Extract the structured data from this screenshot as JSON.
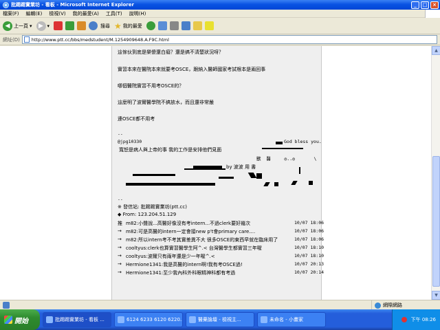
{
  "window": {
    "title": "批踢踢實業坊 - 看板 - Microsoft Internet Explorer",
    "min": "_",
    "max": "□",
    "close": "×"
  },
  "menu": [
    "檔案(F)",
    "編輯(E)",
    "檢視(V)",
    "我的最愛(A)",
    "工具(T)",
    "說明(H)"
  ],
  "toolbar": {
    "back_label": "上一頁",
    "search_label": "搜尋",
    "favorites_label": "我的最愛"
  },
  "address": {
    "label": "網址(D)",
    "url": "http://www.ptt.cc/bbs/medstudent/M.1254909648.A.F9C.html"
  },
  "post": {
    "lines": [
      "這傢伙到底是樂傻還白癡？還是搞不清楚狀況呀？",
      "實習本來在醫院本來就要考OSCE，跟納入醫師國家考試根本是兩回事",
      "哪個醫院實習不用考OSCE的？",
      "這麼明了波爾醫學院不搞放水，而且還非常嚴",
      "連OSCE都不用考"
    ],
    "sig_sep": "--",
    "sig_id": "@jpg10330",
    "sig_bless": "God bless you.",
    "sig_line1": "寬恕是病人與上帝的事 我的工作是安排他們見面",
    "sig_art1": "獸  醫     ◎..◎       \\",
    "sig_by": "by 波波 用 書",
    "footer_sep": "--",
    "footer_site": "※ 發信站: 批踢踢實業坊(ptt.cc)",
    "footer_from": "◆ From: 123.204.51.129",
    "pushes": [
      {
        "tag": "推",
        "text": "m82:小聲說...高醫好像沒有考intern...不過clerk要好幾次",
        "time": "10/07 18:06"
      },
      {
        "tag": "→",
        "text": "m82:可是高醫的intern一定會接new p't會primary care....",
        "time": "10/07 18:06"
      },
      {
        "tag": "→",
        "text": "m82:所以intern考不考其實差異不大 很多OSCE的東西早就在臨床用了",
        "time": "10/07 18:06"
      },
      {
        "tag": "→",
        "text": "cooltyus:clerk也算實習醫學生阿^.< 台灣醫學生都實習三年喔",
        "time": "10/07 18:10"
      },
      {
        "tag": "→",
        "text": "cooltyus:波爾只有兩年還是少一年喔^.<",
        "time": "10/07 18:10"
      },
      {
        "tag": "→",
        "text": "Hermione1341:我是高醫的intern啊!我有考OSCE過!",
        "time": "10/07 20:13"
      },
      {
        "tag": "→",
        "text": "Hermione1341:至少我內科外科眼精神科都有考過",
        "time": "10/07 20:14"
      }
    ]
  },
  "status": {
    "zone": "網際網路"
  },
  "taskbar": {
    "start": "開始",
    "tasks": [
      "批踢踢實業坊 - 看板 ...",
      "6124 6233 6120 6220...",
      "醫藥論壇 - 檢視主...",
      "未命名 - 小畫家"
    ],
    "clock": "下午 08:26"
  },
  "colors": {
    "titlebar": "#0a53e3",
    "post_bg": "#efefef",
    "taskbar": "#245edb",
    "start": "#2e8b2e"
  }
}
